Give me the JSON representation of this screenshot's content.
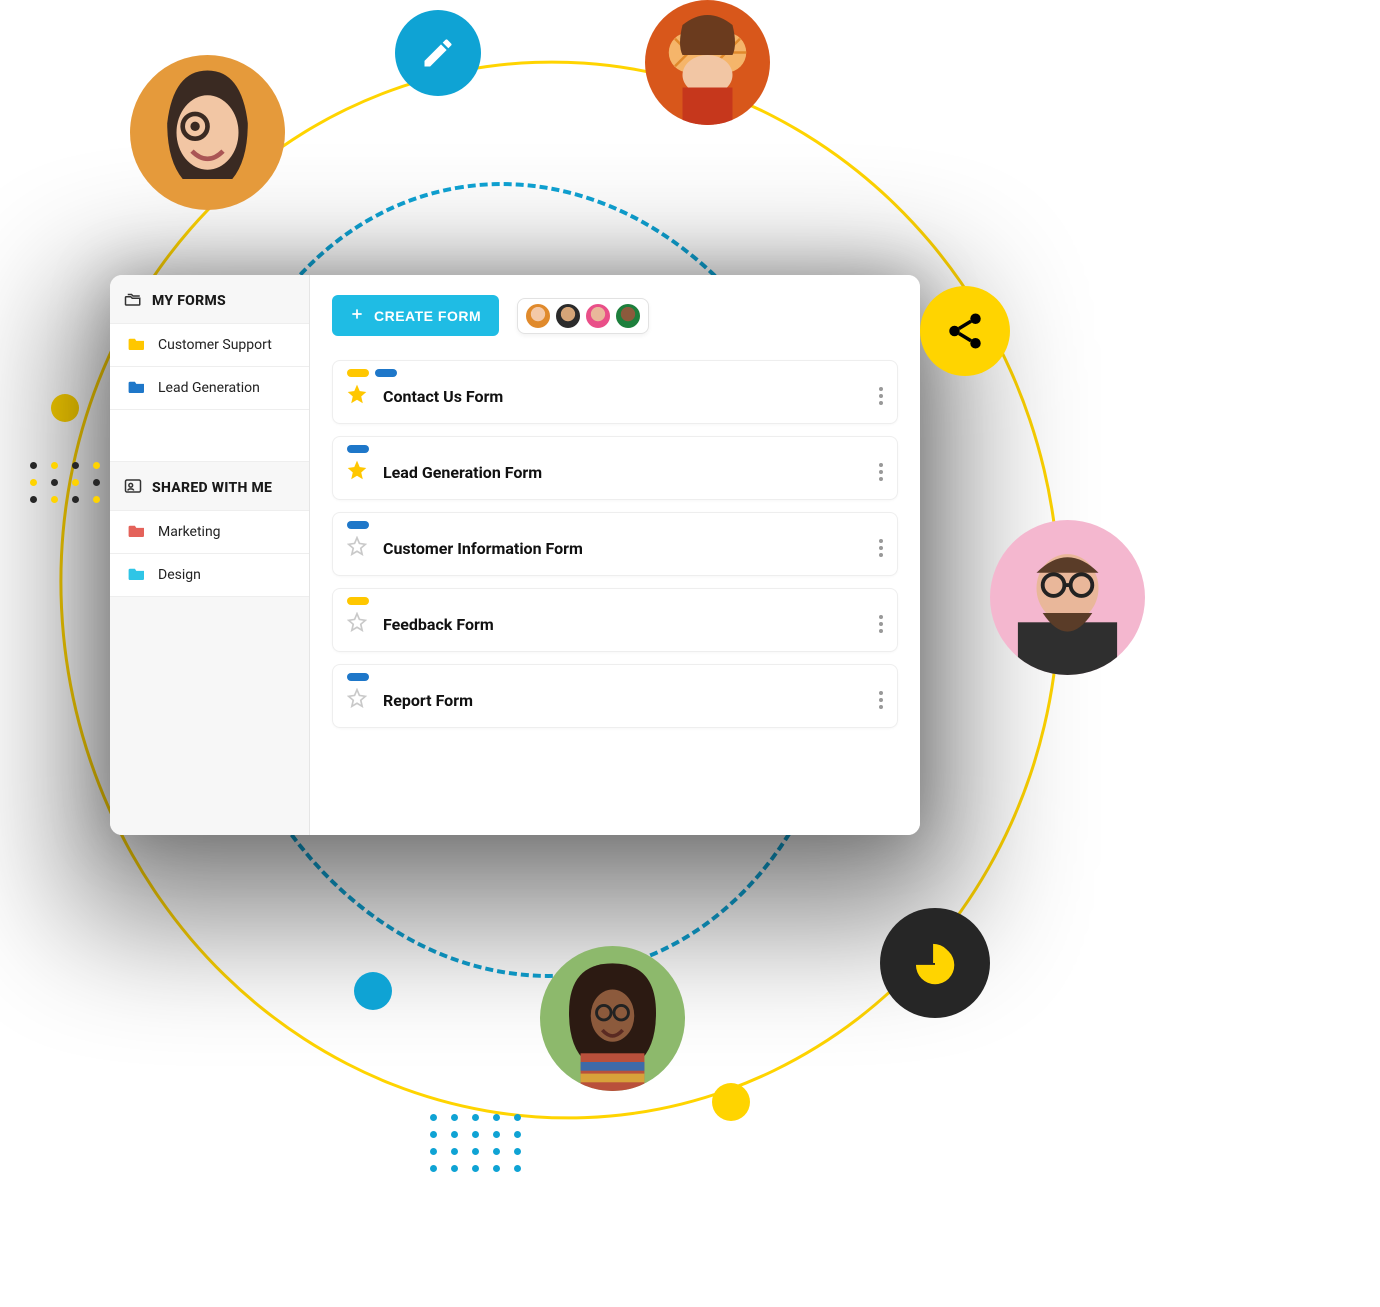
{
  "sidebar": {
    "sections": [
      {
        "key": "my_forms",
        "title": "MY FORMS",
        "items": [
          {
            "label": "Customer Support",
            "color": "#FFC700"
          },
          {
            "label": "Lead Generation",
            "color": "#1E77C9"
          }
        ]
      },
      {
        "key": "shared",
        "title": "SHARED WITH ME",
        "items": [
          {
            "label": "Marketing",
            "color": "#E4625A"
          },
          {
            "label": "Design",
            "color": "#2FC5E6"
          }
        ]
      }
    ]
  },
  "topbar": {
    "create_label": "CREATE FORM",
    "avatars": [
      {
        "bg": "#E08A2C",
        "face": "#F4C9A8"
      },
      {
        "bg": "#2B2B2B",
        "face": "#D6A578"
      },
      {
        "bg": "#E94F88",
        "face": "#E9B79A"
      },
      {
        "bg": "#1D7F3C",
        "face": "#8C5A3C"
      }
    ]
  },
  "forms": [
    {
      "title": "Contact Us Form",
      "starred": true,
      "tags": [
        "#FFC700",
        "#1E77C9"
      ]
    },
    {
      "title": "Lead Generation Form",
      "starred": true,
      "tags": [
        "#1E77C9"
      ]
    },
    {
      "title": "Customer Information Form",
      "starred": false,
      "tags": [
        "#1E77C9"
      ]
    },
    {
      "title": "Feedback Form",
      "starred": false,
      "tags": [
        "#FFC700"
      ]
    },
    {
      "title": "Report Form",
      "starred": false,
      "tags": [
        "#1E77C9"
      ]
    }
  ],
  "colors": {
    "accent_teal": "#1FBCE4",
    "accent_yellow": "#FFD400",
    "star_on": "#FFC700",
    "star_off": "#C9C9C9"
  }
}
